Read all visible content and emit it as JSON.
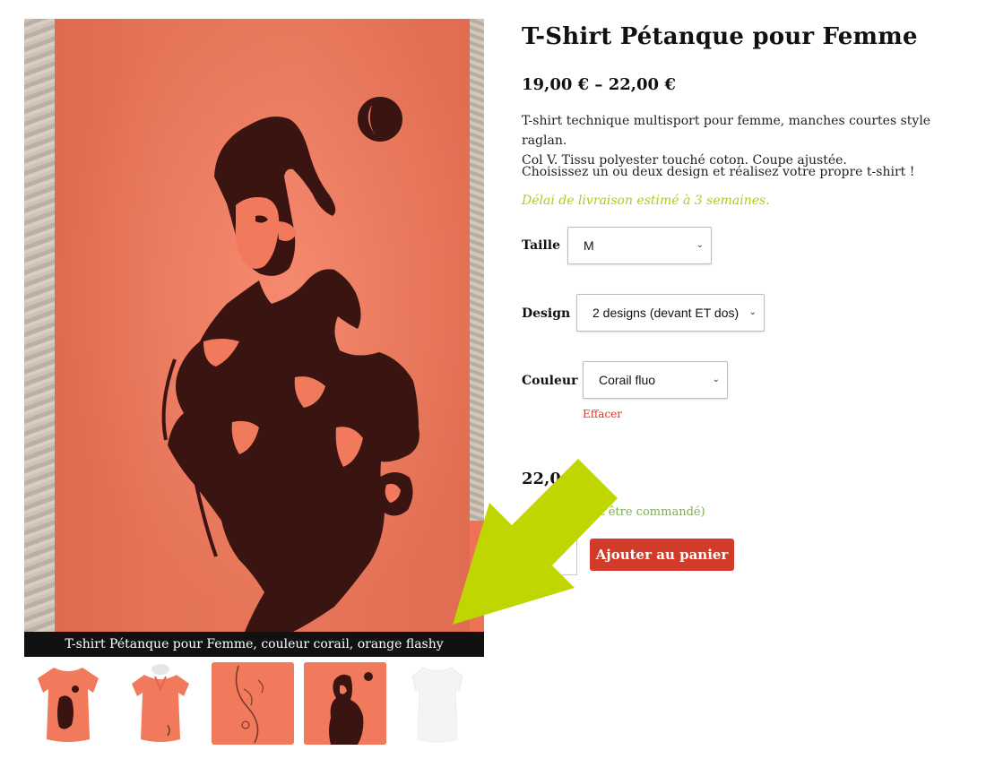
{
  "gallery": {
    "caption": "T-shirt Pétanque pour Femme, couleur corail, orange flashy",
    "thumbnails": [
      "front-print-thumb",
      "plain-front-thumb",
      "back-design-thumb",
      "print-closeup-thumb",
      "white-thumb"
    ]
  },
  "product": {
    "title": "T-Shirt Pétanque pour Femme",
    "price_range": "19,00 € – 22,00 €",
    "description_line1": "T-shirt technique multisport pour femme, manches courtes style raglan.",
    "description_line2": "Col V. Tissu polyester touché coton. Coupe ajustée.",
    "description_para2": "Choisissez un ou deux design et réalisez votre propre t-shirt !",
    "delivery_note": "Délai de livraison estimé à 3 semaines."
  },
  "variations": {
    "size_label": "Taille",
    "size_value": "M",
    "design_label": "Design",
    "design_value": "2 designs (devant ET dos)",
    "color_label": "Couleur",
    "color_value": "Corail fluo",
    "reset_label": "Effacer"
  },
  "purchase": {
    "price_visible": "22,0",
    "stock_visible": "ut être commandé)",
    "add_to_cart": "Ajouter au panier"
  },
  "colors": {
    "accent_red": "#d23b2a",
    "delivery_green": "#b7c61e",
    "arrow_green": "#c0d600",
    "shirt_coral": "#f27a5c"
  }
}
